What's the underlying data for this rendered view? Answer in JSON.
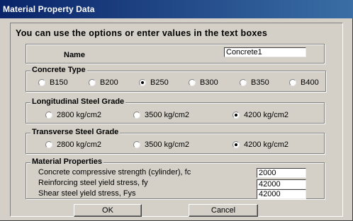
{
  "window": {
    "title": "Material Property Data"
  },
  "headline": "You can use the options or enter values in the text boxes",
  "name_field": {
    "label": "Name",
    "value": "Concrete1"
  },
  "concrete_type": {
    "title": "Concrete Type",
    "options": [
      "B150",
      "B200",
      "B250",
      "B300",
      "B350",
      "B400"
    ],
    "selected": "B250"
  },
  "longitudinal_steel": {
    "title": "Longitudinal Steel Grade",
    "options": [
      "2800 kg/cm2",
      "3500 kg/cm2",
      "4200 kg/cm2"
    ],
    "selected": "4200 kg/cm2"
  },
  "transverse_steel": {
    "title": "Transverse Steel Grade",
    "options": [
      "2800 kg/cm2",
      "3500 kg/cm2",
      "4200 kg/cm2"
    ],
    "selected": "4200 kg/cm2"
  },
  "material_properties": {
    "title": "Material Properties",
    "fields": [
      {
        "label": "Concrete compressive strength (cylinder), fc",
        "value": "2000"
      },
      {
        "label": "Reinforcing steel yield stress, fy",
        "value": "42000"
      },
      {
        "label": "Shear steel yield stress, Fys",
        "value": "42000"
      }
    ]
  },
  "buttons": {
    "ok": "OK",
    "cancel": "Cancel"
  }
}
